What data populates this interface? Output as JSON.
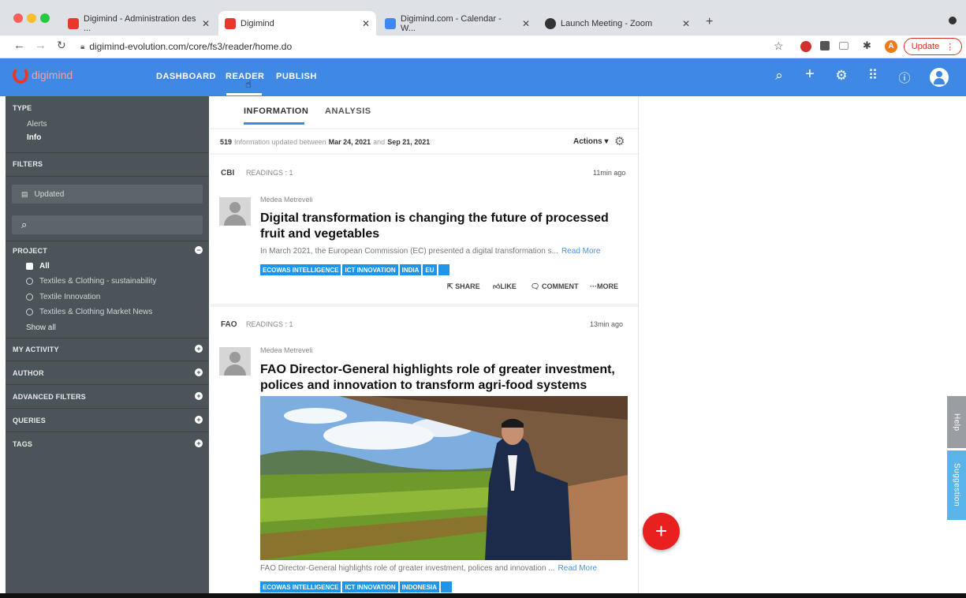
{
  "browser": {
    "tabs": [
      {
        "label": "Digimind - Administration des ..."
      },
      {
        "label": "Digimind"
      },
      {
        "label": "Digimind.com - Calendar - W..."
      },
      {
        "label": "Launch Meeting - Zoom"
      }
    ],
    "url": "digimind-evolution.com/core/fs3/reader/home.do",
    "update_label": "Update",
    "avatar_letter": "A"
  },
  "app": {
    "logo": "digimind",
    "nav": {
      "dashboard": "DASHBOARD",
      "reader": "READER",
      "publish": "PUBLISH"
    },
    "accent": "#3f89e4"
  },
  "sidebar": {
    "type_heading": "TYPE",
    "type_items": [
      "Alerts",
      "Info"
    ],
    "filters_heading": "FILTERS",
    "date_filter": "Updated",
    "project_heading": "PROJECT",
    "projects": [
      "All",
      "Textiles & Clothing - sustainability",
      "Textile Innovation",
      "Textiles & Clothing Market News"
    ],
    "show_all": "Show all",
    "sections": [
      "MY ACTIVITY",
      "AUTHOR",
      "ADVANCED FILTERS",
      "QUERIES",
      "TAGS"
    ]
  },
  "feed": {
    "tabs": [
      "INFORMATION",
      "ANALYSIS"
    ],
    "summary_count": "519",
    "summary_text": "Information updated between",
    "date_from": "Mar 24, 2021",
    "and": "and",
    "date_to": "Sep 21, 2021",
    "actions_label": "Actions",
    "read_more": "Read More",
    "actions": {
      "share": "SHARE",
      "like": "LIKE",
      "comment": "COMMENT",
      "more": "MORE"
    },
    "items": [
      {
        "source": "CBI",
        "readings": "READINGS : 1",
        "time": "11min ago",
        "author": "Medea Metreveli",
        "title": "Digital transformation is changing the future of processed fruit and vegetables",
        "excerpt": "In March 2021, the European Commission (EC) presented a digital transformation s...",
        "tags": [
          "ECOWAS INTELLIGENCE",
          "ICT INNOVATION",
          "INDIA",
          "EU",
          "..."
        ]
      },
      {
        "source": "FAO",
        "readings": "READINGS : 1",
        "time": "13min ago",
        "author": "Medea Metreveli",
        "title": "FAO Director-General highlights role of greater investment, polices and innovation to transform agri-food systems",
        "excerpt": "FAO Director-General highlights role of greater investment, polices and innovation ...",
        "tags": [
          "ECOWAS INTELLIGENCE",
          "ICT INNOVATION",
          "INDONESIA",
          "..."
        ]
      }
    ]
  },
  "side_tabs": {
    "help": "Help",
    "suggestion": "Suggestion"
  },
  "fab_label": "+"
}
